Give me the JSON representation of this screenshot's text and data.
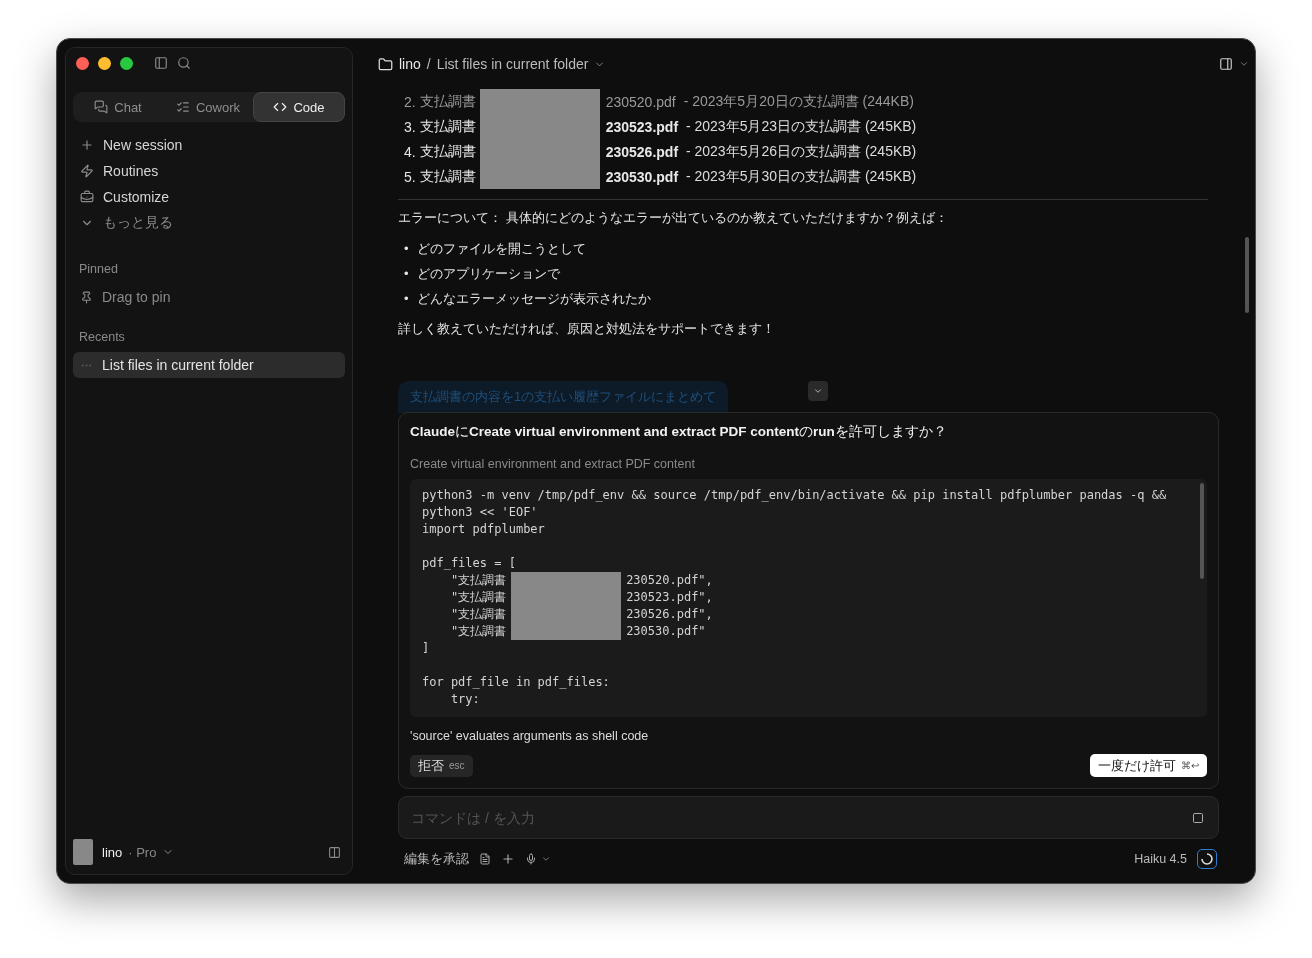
{
  "sidebar": {
    "mode_tabs": [
      {
        "label": "Chat",
        "selected": false
      },
      {
        "label": "Cowork",
        "selected": false
      },
      {
        "label": "Code",
        "selected": true
      }
    ],
    "nav": [
      {
        "label": "New session",
        "dim": false
      },
      {
        "label": "Routines",
        "dim": false
      },
      {
        "label": "Customize",
        "dim": false
      },
      {
        "label": "もっと見る",
        "dim": true
      }
    ],
    "pinned": {
      "heading": "Pinned",
      "hint": "Drag to pin"
    },
    "recents": {
      "heading": "Recents",
      "items": [
        {
          "label": "List files in current folder",
          "selected": true
        }
      ]
    },
    "account": {
      "name": "lino",
      "plan": "· Pro"
    }
  },
  "header": {
    "folder": "lino",
    "separator": "/",
    "title": "List files in current folder"
  },
  "file_list": [
    {
      "number": "2.",
      "prefix": "支払調書",
      "file": "230520.pdf",
      "detail": " - 2023年5月20日の支払調書 (244KB)",
      "faded": true
    },
    {
      "number": "3.",
      "prefix": "支払調書",
      "file": "230523.pdf",
      "detail": " - 2023年5月23日の支払調書 (245KB)",
      "faded": false
    },
    {
      "number": "4.",
      "prefix": "支払調書",
      "file": "230526.pdf",
      "detail": " - 2023年5月26日の支払調書 (245KB)",
      "faded": false
    },
    {
      "number": "5.",
      "prefix": "支払調書",
      "file": "230530.pdf",
      "detail": " - 2023年5月30日の支払調書 (245KB)",
      "faded": false
    }
  ],
  "message": {
    "intro": "エラーについて： 具体的にどのようなエラーが出ているのか教えていただけますか？例えば：",
    "bullets": [
      {
        "marker": "•",
        "text": "どのファイルを開こうとして"
      },
      {
        "marker": "•",
        "text": "どのアプリケーションで"
      },
      {
        "marker": "•",
        "text": "どんなエラーメッセージが表示されたか"
      }
    ],
    "outro": "詳しく教えていただければ、原因と対処法をサポートできます！"
  },
  "queued_message": "支払調書の内容を1の支払い履歴ファイルにまとめて",
  "permission": {
    "title": "**Claude**に**Create virtual environment and extract PDF content**の**run**を許可しますか？",
    "subtitle": "Create virtual environment and extract PDF content",
    "code": [
      {
        "kind": "plain",
        "text": "python3 -m venv /tmp/pdf_env && source /tmp/pdf_env/bin/activate && pip install pdfplumber pandas -q &&"
      },
      {
        "kind": "plain",
        "text": "python3 << 'EOF'"
      },
      {
        "kind": "plain",
        "text": "import pdfplumber"
      },
      {
        "kind": "blank"
      },
      {
        "kind": "plain",
        "text": "pdf_files = ["
      },
      {
        "kind": "redacted",
        "before": "    \"支払調書",
        "after": "230520.pdf\","
      },
      {
        "kind": "redacted",
        "before": "    \"支払調書",
        "after": "230523.pdf\","
      },
      {
        "kind": "redacted",
        "before": "    \"支払調書",
        "after": "230526.pdf\","
      },
      {
        "kind": "redacted",
        "before": "    \"支払調書",
        "after": "230530.pdf\""
      },
      {
        "kind": "plain",
        "text": "]"
      },
      {
        "kind": "blank"
      },
      {
        "kind": "plain",
        "text": "for pdf_file in pdf_files:"
      },
      {
        "kind": "plain",
        "text": "    try:"
      }
    ],
    "warning": "'source' evaluates arguments as shell code",
    "deny": {
      "label": "拒否",
      "shortcut": "esc"
    },
    "allow": {
      "label": "一度だけ許可",
      "shortcut": "⌘↩"
    }
  },
  "composer": {
    "placeholder": "コマンドは / を入力"
  },
  "footer": {
    "mode": "編集を承認",
    "model": "Haiku 4.5"
  }
}
